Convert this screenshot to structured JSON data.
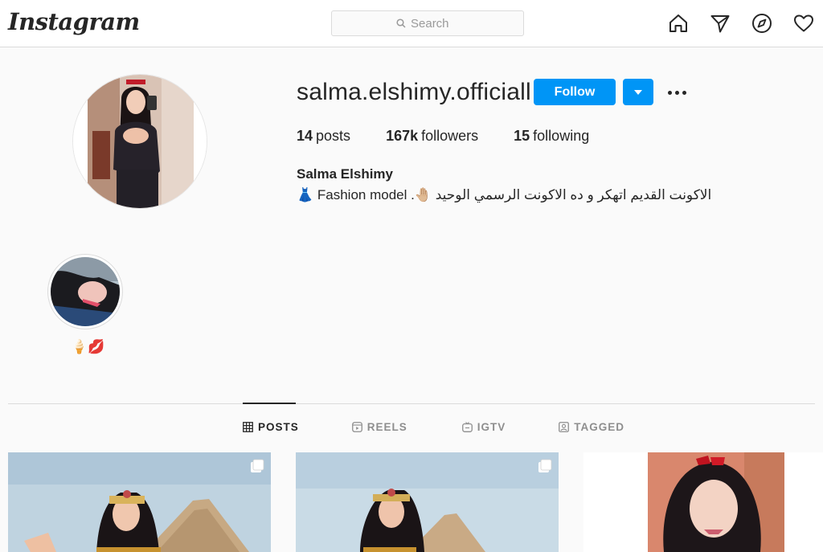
{
  "header": {
    "logo": "Instagram",
    "search_placeholder": "Search",
    "nav_icons": [
      "home-icon",
      "direct-icon",
      "explore-icon",
      "activity-heart-icon"
    ]
  },
  "profile": {
    "username": "salma.elshimy.officiall",
    "follow_label": "Follow",
    "stats": {
      "posts_count": "14",
      "posts_label": "posts",
      "followers_count": "167k",
      "followers_label": "followers",
      "following_count": "15",
      "following_label": "following"
    },
    "full_name": "Salma Elshimy",
    "bio": "الاكونت القديم اتهكر و ده الاكونت الرسمي الوحيد 🤚🏼. Fashion model 👗"
  },
  "highlights": [
    {
      "label": "🍦💋"
    }
  ],
  "tabs": [
    {
      "label": "POSTS",
      "icon": "grid-icon",
      "active": true
    },
    {
      "label": "REELS",
      "icon": "reels-icon",
      "active": false
    },
    {
      "label": "IGTV",
      "icon": "igtv-icon",
      "active": false
    },
    {
      "label": "TAGGED",
      "icon": "tagged-icon",
      "active": false
    }
  ],
  "colors": {
    "primary_button": "#0095f6",
    "text": "#262626",
    "muted": "#8e8e8e",
    "border": "#dbdbdb",
    "background": "#fafafa"
  }
}
